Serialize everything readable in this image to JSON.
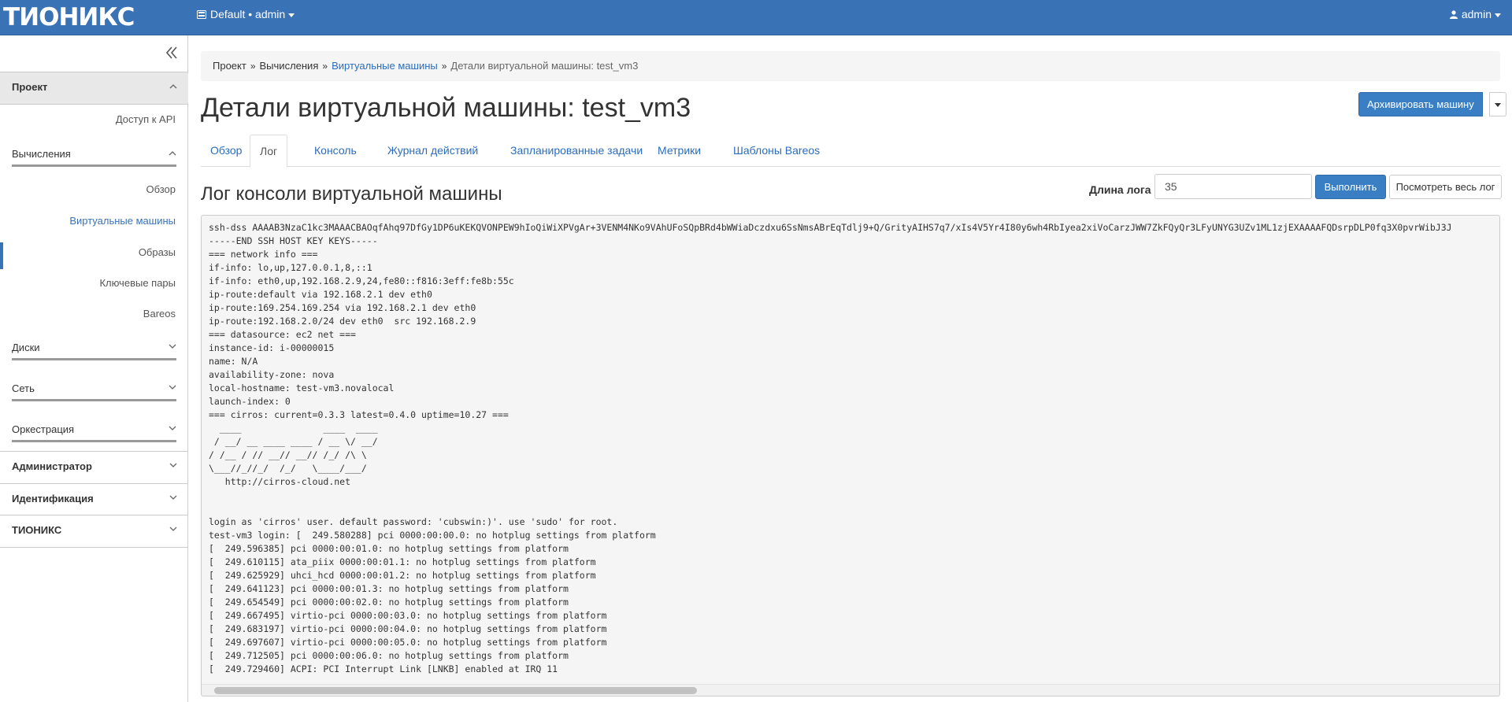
{
  "navbar": {
    "brand": "ТИОНИКС",
    "project_picker": "Default • admin",
    "user_menu": "admin"
  },
  "sidebar": {
    "sections": [
      {
        "label": "Проект"
      },
      {
        "label": "Администратор"
      },
      {
        "label": "Идентификация"
      },
      {
        "label": "ТИОНИКС"
      }
    ],
    "project_items": {
      "api_access": "Доступ к API",
      "compute_group": "Вычисления",
      "compute_items": [
        "Обзор",
        "Виртуальные машины",
        "Образы",
        "Ключевые пары",
        "Bareos"
      ],
      "disks_group": "Диски",
      "network_group": "Сеть",
      "orchestration_group": "Оркестрация"
    }
  },
  "breadcrumb": {
    "items": [
      "Проект",
      "Вычисления",
      "Виртуальные машины",
      "Детали виртуальной машины: test_vm3"
    ]
  },
  "page": {
    "title": "Детали виртуальной машины: test_vm3",
    "action_button": "Архивировать машину"
  },
  "tabs": [
    "Обзор",
    "Лог",
    "Консоль",
    "Журнал действий",
    "Запланированные задачи",
    "Метрики",
    "Шаблоны Bareos"
  ],
  "active_tab": "Лог",
  "log_section": {
    "title": "Лог консоли виртуальной машины",
    "length_label": "Длина лога",
    "length_value": "35",
    "run_button": "Выполнить",
    "view_all_button": "Посмотреть весь лог"
  },
  "console_lines": [
    "ssh-dss AAAAB3NzaC1kc3MAAACBAOqfAhq97DfGy1DP6uKEKQVONPEW9hIoQiWiXPVgAr+3VENM4NKo9VAhUFoSQpBRd4bWWiaDczdxu6SsNmsABrEqTdlj9+Q/GrityAIHS7q7/xIs4V5Yr4I80y6wh4RbIyea2xiVoCarzJWW7ZkFQyQr3LFyUNYG3UZv1ML1zjEXAAAAFQDsrpDLP0fq3X0pvrWibJ3J",
    "-----END SSH HOST KEY KEYS-----",
    "=== network info ===",
    "if-info: lo,up,127.0.0.1,8,::1",
    "if-info: eth0,up,192.168.2.9,24,fe80::f816:3eff:fe8b:55c",
    "ip-route:default via 192.168.2.1 dev eth0",
    "ip-route:169.254.169.254 via 192.168.2.1 dev eth0",
    "ip-route:192.168.2.0/24 dev eth0  src 192.168.2.9",
    "=== datasource: ec2 net ===",
    "instance-id: i-00000015",
    "name: N/A",
    "availability-zone: nova",
    "local-hostname: test-vm3.novalocal",
    "launch-index: 0",
    "=== cirros: current=0.3.3 latest=0.4.0 uptime=10.27 ===",
    "  ____               ____  ____",
    " / __/ __ ____ ____ / __ \\/ __/",
    "/ /__ / // __// __// /_/ /\\ \\",
    "\\___//_//_/  /_/   \\____/___/",
    "   http://cirros-cloud.net",
    "",
    "",
    "login as 'cirros' user. default password: 'cubswin:)'. use 'sudo' for root.",
    "test-vm3 login: [  249.580288] pci 0000:00:00.0: no hotplug settings from platform",
    "[  249.596385] pci 0000:00:01.0: no hotplug settings from platform",
    "[  249.610115] ata_piix 0000:00:01.1: no hotplug settings from platform",
    "[  249.625929] uhci_hcd 0000:00:01.2: no hotplug settings from platform",
    "[  249.641123] pci 0000:00:01.3: no hotplug settings from platform",
    "[  249.654549] pci 0000:00:02.0: no hotplug settings from platform",
    "[  249.667495] virtio-pci 0000:00:03.0: no hotplug settings from platform",
    "[  249.683197] virtio-pci 0000:00:04.0: no hotplug settings from platform",
    "[  249.697607] virtio-pci 0000:00:05.0: no hotplug settings from platform",
    "[  249.712505] pci 0000:00:06.0: no hotplug settings from platform",
    "[  249.729460] ACPI: PCI Interrupt Link [LNKB] enabled at IRQ 11"
  ],
  "icons": {
    "project_picker": "server-icon",
    "user": "user-icon",
    "collapse": "double-chevron-left-icon"
  },
  "colors": {
    "navbar": "#3a72b6",
    "primary_button": "#3a7fc4",
    "link": "#2a6dbd"
  }
}
